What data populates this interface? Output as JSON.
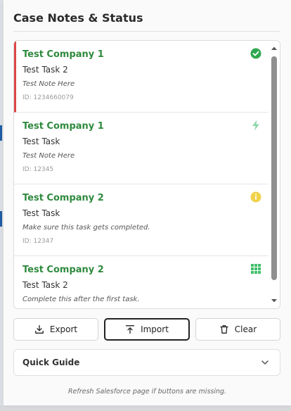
{
  "panel": {
    "title": "Case Notes & Status"
  },
  "cards": [
    {
      "company": "Test Company 1",
      "task": "Test Task 2",
      "note": "Test Note Here",
      "id": "ID: 1234660079",
      "status_icon": "check-circle-icon",
      "status_color": "#2fa84f"
    },
    {
      "company": "Test Company 1",
      "task": "Test Task",
      "note": "Test Note Here",
      "id": "ID: 12345",
      "status_icon": "lightning-icon",
      "status_color": "#8fd6ad"
    },
    {
      "company": "Test Company 2",
      "task": "Test Task",
      "note": "Make sure this task gets completed.",
      "id": "ID: 12347",
      "status_icon": "info-circle-icon",
      "status_color": "#f0d24a"
    },
    {
      "company": "Test Company 2",
      "task": "Test Task 2",
      "note": "Complete this after the first task.",
      "id": "",
      "status_icon": "grid-icon",
      "status_color": "#3fbf6a"
    }
  ],
  "buttons": {
    "export_label": "Export",
    "import_label": "Import",
    "clear_label": "Clear"
  },
  "quick_guide": {
    "label": "Quick Guide"
  },
  "footer": {
    "note": "Refresh Salesforce page if buttons are missing."
  },
  "colors": {
    "company_text": "#2f8a3e",
    "active_marker": "#dc4545"
  }
}
